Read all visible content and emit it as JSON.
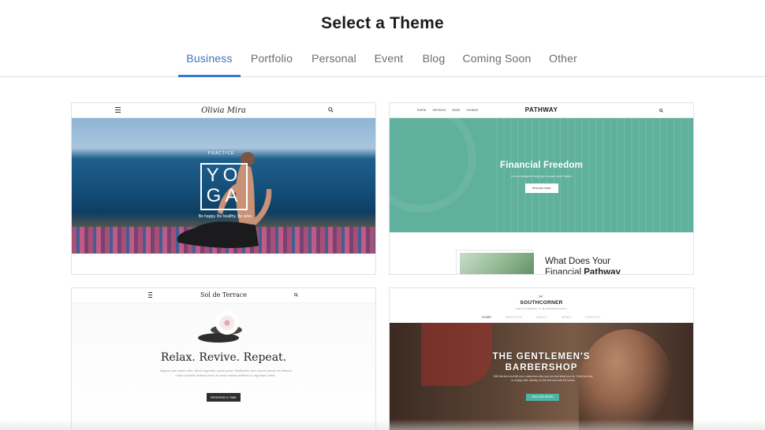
{
  "page": {
    "title": "Select a Theme"
  },
  "tabs": [
    {
      "label": "Business",
      "active": true
    },
    {
      "label": "Portfolio",
      "active": false
    },
    {
      "label": "Personal",
      "active": false
    },
    {
      "label": "Event",
      "active": false
    },
    {
      "label": "Blog",
      "active": false
    },
    {
      "label": "Coming Soon",
      "active": false
    },
    {
      "label": "Other",
      "active": false
    }
  ],
  "colors": {
    "accent": "#3a76c9",
    "tab_inactive": "#6c6c6c",
    "pathway_teal": "#5fb09d",
    "barber_button": "#4db5a3"
  },
  "themes": {
    "yoga": {
      "logo": "Olivia Mira",
      "kicker": "PRACTICE",
      "headline_line1": "YO",
      "headline_line2": "GA",
      "subtitle": "Be happy. Be healthy. Be alive."
    },
    "pathway": {
      "nav": [
        "home",
        "services",
        "team",
        "contact"
      ],
      "logo": "PATHWAY",
      "hero_title": "Financial Freedom",
      "hero_text": "Let us advisors help you secure your future",
      "hero_button": "find out more",
      "section_title_pre": "What Does Your",
      "section_title_mid": "Financial ",
      "section_title_bold": "Pathway"
    },
    "spa": {
      "logo": "Sol de Terrace",
      "headline": "Relax. Revive. Repeat.",
      "paragraph": "Aliquam est ornare nibh. Morbi dignissim porta porta. Vestibulum sed ornare lacinia vel ultrices nulla Curabitur finibus lorem sit amet massa eleifend eu dignissim diam.",
      "button": "RESERVE A TIME"
    },
    "barber": {
      "logo": "SOUTHCORNER",
      "tagline": "GENTLEMEN'S BARBERSHOP",
      "menu": [
        "HOME",
        "SERVICES",
        "ABOUT",
        "NEWS",
        "CONTACT"
      ],
      "headline_line1": "THE GENTLEMEN'S",
      "headline_line2": "BARBERSHOP",
      "paragraph": "Edit this text and tell your customers who you are and what you do. Click this text, or simply click directly on the text and edit the words.",
      "button": "SEE OUR WORK"
    }
  }
}
